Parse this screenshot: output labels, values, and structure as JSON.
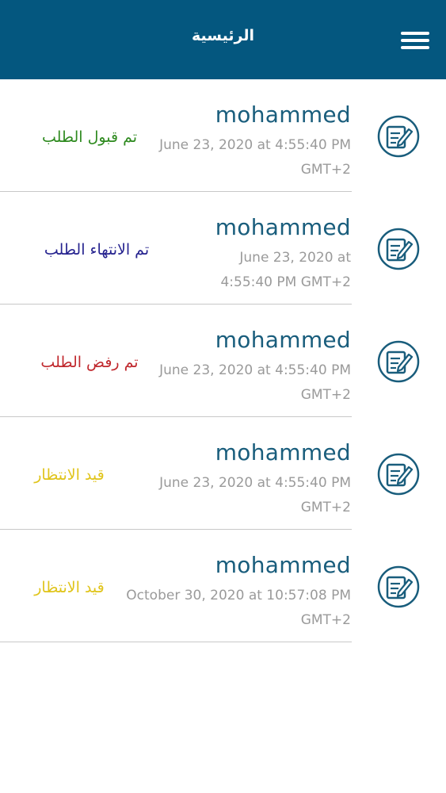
{
  "header": {
    "title": "الرئيسية",
    "menu_icon": "hamburger-menu-icon",
    "background": "#04577f"
  },
  "colors": {
    "name": "#195d7c",
    "date": "#9a9a9a",
    "icon": "#195d7c"
  },
  "items": [
    {
      "name": "mohammed",
      "date": "June 23, 2020 at 4:55:40 PM GMT+2",
      "status": "تم قبول الطلب",
      "status_color": "#2e8a1f",
      "icon": "edit-document-icon"
    },
    {
      "name": "mohammed",
      "date": "June 23, 2020 at 4:55:40 PM GMT+2",
      "status": "تم الانتهاء الطلب",
      "status_color": "#26238f",
      "icon": "edit-document-icon"
    },
    {
      "name": "mohammed",
      "date": "June 23, 2020 at 4:55:40 PM GMT+2",
      "status": "تم رفض الطلب",
      "status_color": "#c0282d",
      "icon": "edit-document-icon"
    },
    {
      "name": "mohammed",
      "date": "June 23, 2020 at 4:55:40 PM GMT+2",
      "status": "قيد الانتظار",
      "status_color": "#e0c41a",
      "icon": "edit-document-icon"
    },
    {
      "name": "mohammed",
      "date": "October 30, 2020 at 10:57:08 PM GMT+2",
      "status": "قيد الانتظار",
      "status_color": "#e0c41a",
      "icon": "edit-document-icon"
    }
  ]
}
